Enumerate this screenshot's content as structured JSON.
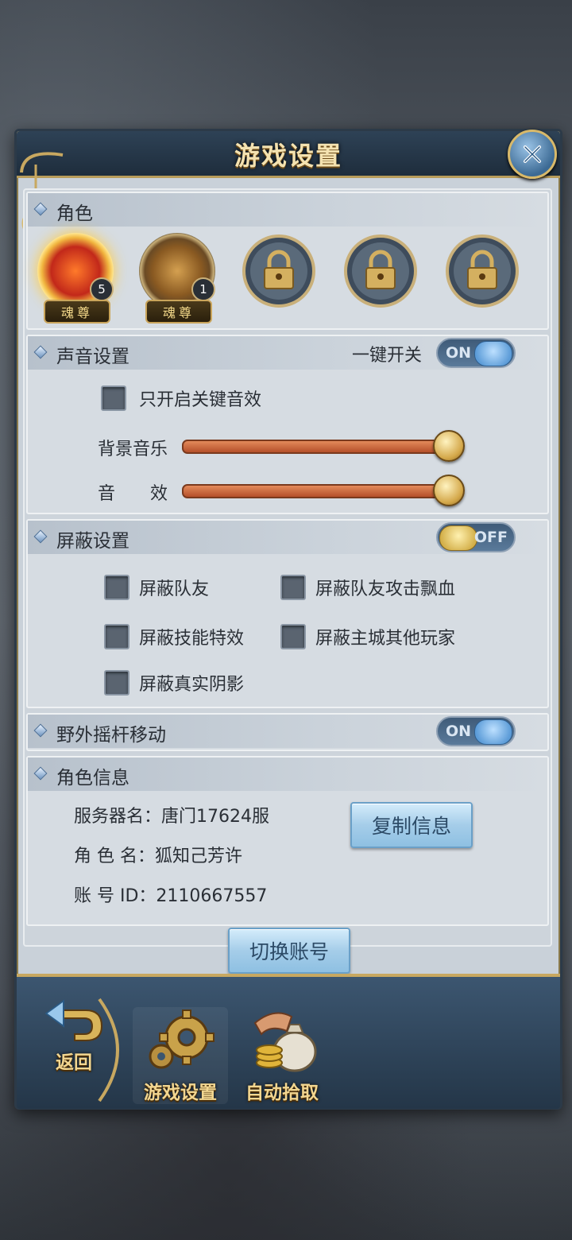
{
  "title": "游戏设置",
  "roles": {
    "section_title": "角色",
    "slots": [
      {
        "rank": "魂尊",
        "level": "5",
        "icon": "phoenix-icon"
      },
      {
        "rank": "魂尊",
        "level": "1",
        "icon": "bear-icon"
      },
      {
        "icon": "lock-icon"
      },
      {
        "icon": "lock-icon"
      },
      {
        "icon": "lock-icon"
      }
    ]
  },
  "sound": {
    "section_title": "声音设置",
    "master_label": "一键开关",
    "master_state": "ON",
    "key_sound_only": "只开启关键音效",
    "bgm_label": "背景音乐",
    "bgm_level": 0.97,
    "sfx_label": "音　　效",
    "sfx_level": 0.97
  },
  "block": {
    "section_title": "屏蔽设置",
    "state": "OFF",
    "options": [
      "屏蔽队友",
      "屏蔽队友攻击飘血",
      "屏蔽技能特效",
      "屏蔽主城其他玩家",
      "屏蔽真实阴影"
    ]
  },
  "joystick": {
    "section_title": "野外摇杆移动",
    "state": "ON"
  },
  "info": {
    "section_title": "角色信息",
    "server_label": "服务器名：",
    "server_value": "唐门17624服",
    "role_label": "角 色 名：",
    "role_value": "狐知己芳许",
    "id_label": "账 号 ID：",
    "id_value": "2110667557",
    "copy_button": "复制信息"
  },
  "switch_account": "切换账号",
  "nav": {
    "back": "返回",
    "settings": "游戏设置",
    "auto_pickup": "自动拾取"
  },
  "colors": {
    "accent_gold": "#c8a860",
    "panel": "#c9d1d9",
    "slider": "#d9743e"
  }
}
